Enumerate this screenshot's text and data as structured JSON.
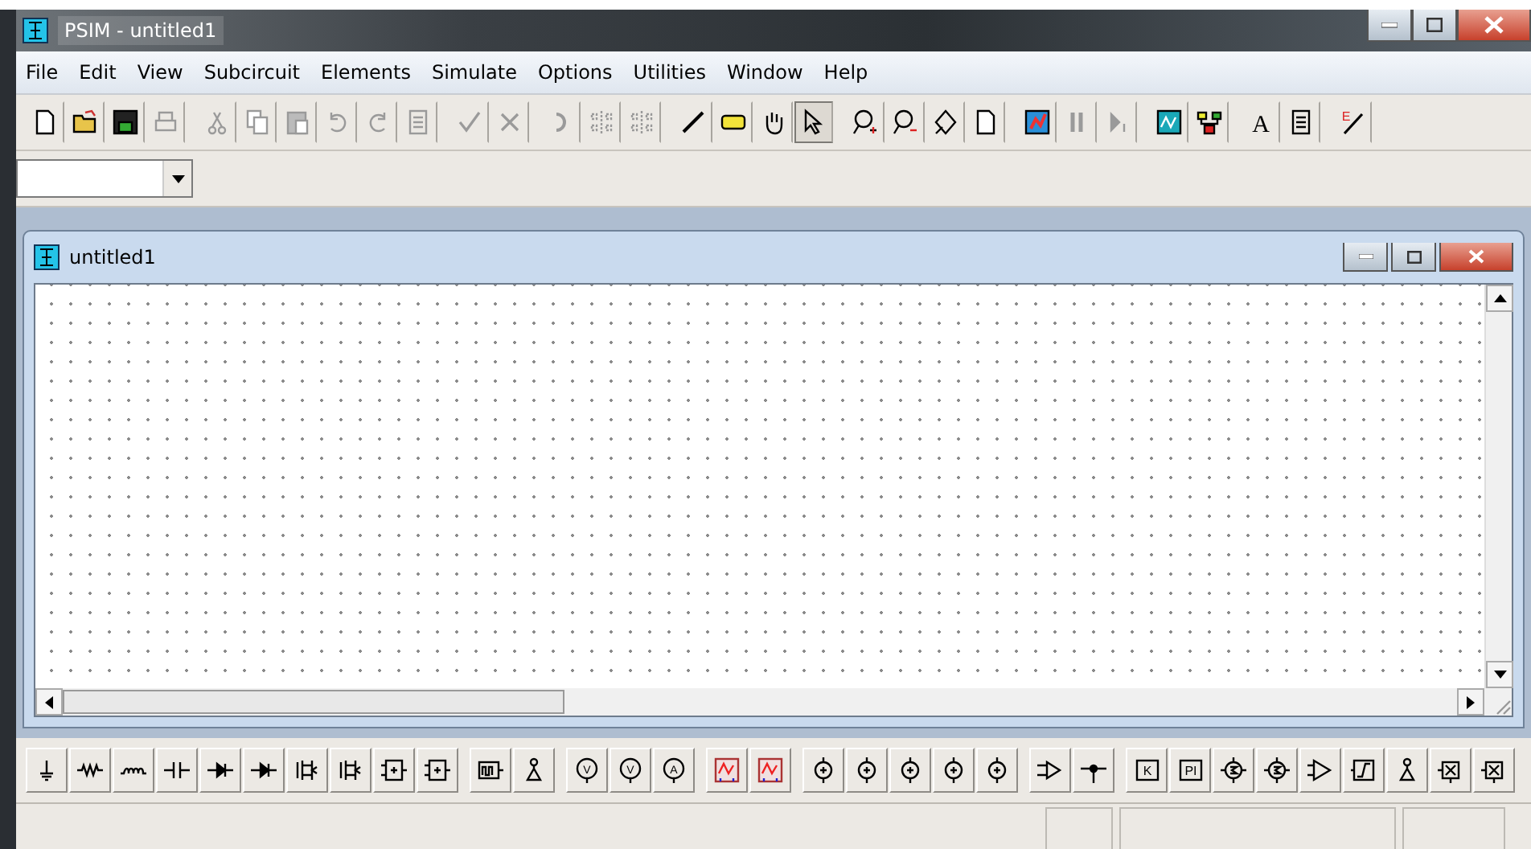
{
  "window": {
    "title": "PSIM - untitled1"
  },
  "menu": [
    "File",
    "Edit",
    "View",
    "Subcircuit",
    "Elements",
    "Simulate",
    "Options",
    "Utilities",
    "Window",
    "Help"
  ],
  "toolbar": [
    [
      {
        "kind": "new-page",
        "disabled": false,
        "selected": false
      },
      {
        "kind": "folder",
        "disabled": false,
        "selected": false
      },
      {
        "kind": "floppy",
        "disabled": false,
        "selected": false
      },
      {
        "kind": "printer",
        "disabled": true,
        "selected": false
      }
    ],
    [
      {
        "kind": "scissors",
        "disabled": true,
        "selected": false
      },
      {
        "kind": "copy",
        "disabled": true,
        "selected": false
      },
      {
        "kind": "clipboard",
        "disabled": true,
        "selected": false
      },
      {
        "kind": "undo",
        "disabled": true,
        "selected": false
      },
      {
        "kind": "redo",
        "disabled": true,
        "selected": false
      },
      {
        "kind": "list",
        "disabled": true,
        "selected": false
      }
    ],
    [
      {
        "kind": "check",
        "disabled": true,
        "selected": false
      },
      {
        "kind": "cross",
        "disabled": true,
        "selected": false
      }
    ],
    [
      {
        "kind": "rotate",
        "disabled": true,
        "selected": false
      },
      {
        "kind": "mirror",
        "disabled": true,
        "selected": false
      },
      {
        "kind": "mirror",
        "disabled": true,
        "selected": false
      }
    ],
    [
      {
        "kind": "pencil",
        "disabled": false,
        "selected": false
      },
      {
        "kind": "tag",
        "disabled": false,
        "selected": false
      },
      {
        "kind": "hand",
        "disabled": false,
        "selected": false
      },
      {
        "kind": "pointer",
        "disabled": false,
        "selected": true
      }
    ],
    [
      {
        "kind": "zoom-in",
        "disabled": false,
        "selected": false
      },
      {
        "kind": "zoom-out",
        "disabled": false,
        "selected": false
      },
      {
        "kind": "diamond",
        "disabled": false,
        "selected": false
      },
      {
        "kind": "new-page",
        "disabled": false,
        "selected": false
      }
    ],
    [
      {
        "kind": "run",
        "disabled": false,
        "selected": false
      },
      {
        "kind": "pause",
        "disabled": true,
        "selected": false
      },
      {
        "kind": "step",
        "disabled": true,
        "selected": false
      }
    ],
    [
      {
        "kind": "waveform",
        "disabled": false,
        "selected": false
      },
      {
        "kind": "blocks",
        "disabled": false,
        "selected": false
      }
    ],
    [
      {
        "kind": "letter",
        "glyph": "A",
        "disabled": false,
        "selected": false
      },
      {
        "kind": "list",
        "disabled": false,
        "selected": false
      }
    ],
    [
      {
        "kind": "letter-pen",
        "glyph": "E",
        "disabled": false,
        "selected": false
      }
    ]
  ],
  "document": {
    "title": "untitled1"
  },
  "palette": [
    [
      {
        "kind": "ground"
      },
      {
        "kind": "resistor"
      },
      {
        "kind": "inductor"
      },
      {
        "kind": "capacitor"
      },
      {
        "kind": "diode"
      },
      {
        "kind": "diode"
      },
      {
        "kind": "switch"
      },
      {
        "kind": "switch"
      },
      {
        "kind": "module"
      },
      {
        "kind": "module"
      }
    ],
    [
      {
        "kind": "pulse"
      },
      {
        "kind": "probe"
      }
    ],
    [
      {
        "kind": "meter",
        "glyph": "V"
      },
      {
        "kind": "meter",
        "glyph": "V"
      },
      {
        "kind": "meter",
        "glyph": "A"
      }
    ],
    [
      {
        "kind": "scope"
      },
      {
        "kind": "scope"
      }
    ],
    [
      {
        "kind": "source"
      },
      {
        "kind": "source"
      },
      {
        "kind": "source"
      },
      {
        "kind": "source"
      },
      {
        "kind": "source"
      }
    ],
    [
      {
        "kind": "comparator"
      },
      {
        "kind": "node"
      }
    ],
    [
      {
        "kind": "gain",
        "glyph": "K"
      },
      {
        "kind": "gain",
        "glyph": "PI"
      },
      {
        "kind": "summer"
      },
      {
        "kind": "summer"
      },
      {
        "kind": "amplifier"
      },
      {
        "kind": "limiter"
      },
      {
        "kind": "probe"
      },
      {
        "kind": "multiplier"
      },
      {
        "kind": "multiplier"
      }
    ]
  ]
}
